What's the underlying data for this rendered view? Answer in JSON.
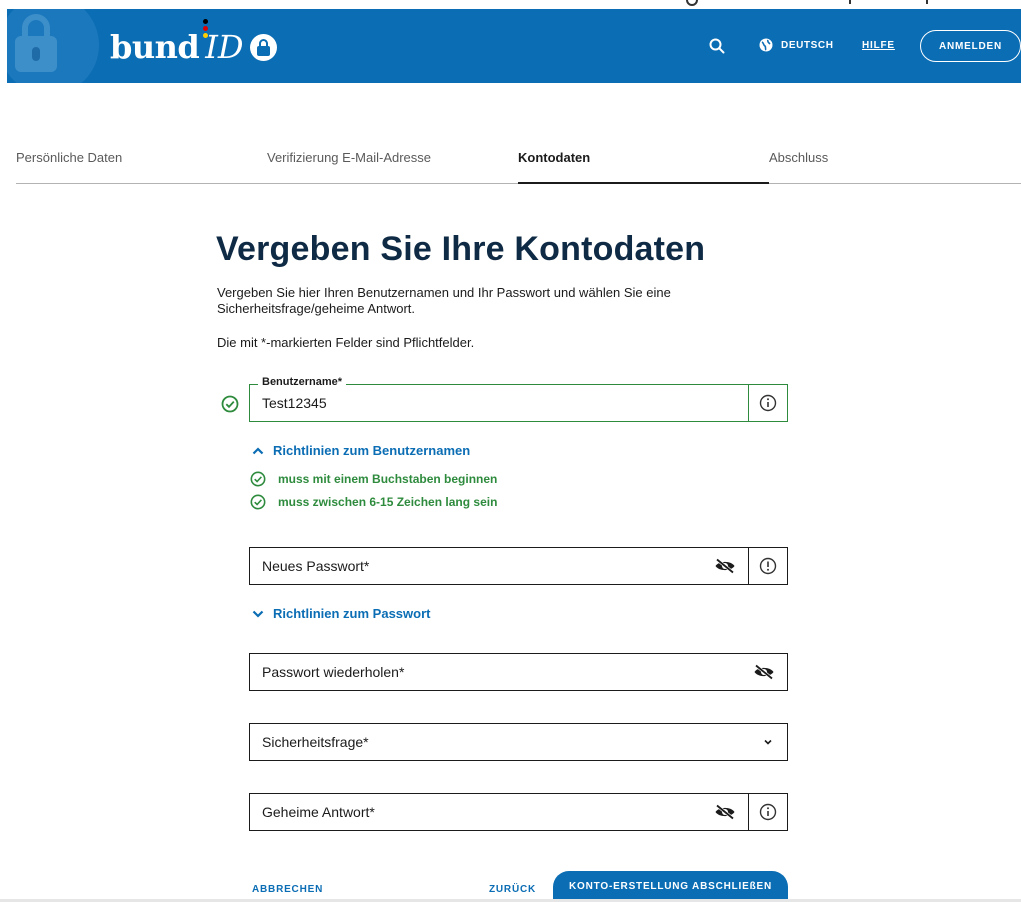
{
  "header": {
    "logo_bund": "bund",
    "logo_id": "ID",
    "language_label": "DEUTSCH",
    "help_label": "HILFE",
    "login_label": "ANMELDEN",
    "flag_colors": [
      "#000000",
      "#dd0000",
      "#ffce00"
    ],
    "brand_color": "#0b6db4"
  },
  "steps": [
    {
      "label": "Persönliche Daten",
      "active": false
    },
    {
      "label": "Verifizierung E-Mail-Adresse",
      "active": false
    },
    {
      "label": "Kontodaten",
      "active": true
    },
    {
      "label": "Abschluss",
      "active": false
    }
  ],
  "main": {
    "title": "Vergeben Sie Ihre Kontodaten",
    "intro": "Vergeben Sie hier Ihren Benutzernamen und Ihr Passwort und wählen Sie eine Sicherheitsfrage/geheime Antwort.",
    "required_note": "Die mit *-markierten Felder sind Pflichtfelder."
  },
  "username": {
    "label": "Benutzername*",
    "value": "Test12345",
    "guidelines_toggle": "Richtlinien zum Benutzernamen",
    "rules": [
      "muss mit einem Buchstaben beginnen",
      "muss zwischen 6-15 Zeichen lang sein"
    ]
  },
  "password": {
    "placeholder": "Neues Passwort*",
    "guidelines_toggle": "Richtlinien zum Passwort"
  },
  "password_repeat": {
    "placeholder": "Passwort wiederholen*"
  },
  "security_question": {
    "placeholder": "Sicherheitsfrage*"
  },
  "secret_answer": {
    "placeholder": "Geheime Antwort*"
  },
  "actions": {
    "cancel": "ABBRECHEN",
    "back": "ZURÜCK",
    "submit": "KONTO-ERSTELLUNG ABSCHLIEßEN"
  },
  "colors": {
    "valid_green": "#2e8b3d",
    "heading": "#0e2a44"
  }
}
